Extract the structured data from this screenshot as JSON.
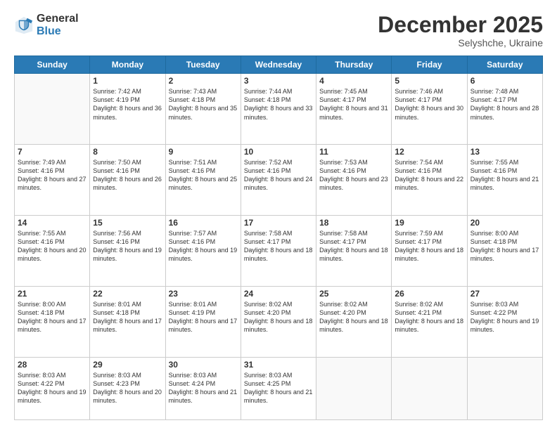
{
  "logo": {
    "general": "General",
    "blue": "Blue"
  },
  "header": {
    "month": "December 2025",
    "location": "Selyshche, Ukraine"
  },
  "days": [
    "Sunday",
    "Monday",
    "Tuesday",
    "Wednesday",
    "Thursday",
    "Friday",
    "Saturday"
  ],
  "weeks": [
    [
      {
        "num": "",
        "sunrise": "",
        "sunset": "",
        "daylight": ""
      },
      {
        "num": "1",
        "sunrise": "Sunrise: 7:42 AM",
        "sunset": "Sunset: 4:19 PM",
        "daylight": "Daylight: 8 hours and 36 minutes."
      },
      {
        "num": "2",
        "sunrise": "Sunrise: 7:43 AM",
        "sunset": "Sunset: 4:18 PM",
        "daylight": "Daylight: 8 hours and 35 minutes."
      },
      {
        "num": "3",
        "sunrise": "Sunrise: 7:44 AM",
        "sunset": "Sunset: 4:18 PM",
        "daylight": "Daylight: 8 hours and 33 minutes."
      },
      {
        "num": "4",
        "sunrise": "Sunrise: 7:45 AM",
        "sunset": "Sunset: 4:17 PM",
        "daylight": "Daylight: 8 hours and 31 minutes."
      },
      {
        "num": "5",
        "sunrise": "Sunrise: 7:46 AM",
        "sunset": "Sunset: 4:17 PM",
        "daylight": "Daylight: 8 hours and 30 minutes."
      },
      {
        "num": "6",
        "sunrise": "Sunrise: 7:48 AM",
        "sunset": "Sunset: 4:17 PM",
        "daylight": "Daylight: 8 hours and 28 minutes."
      }
    ],
    [
      {
        "num": "7",
        "sunrise": "Sunrise: 7:49 AM",
        "sunset": "Sunset: 4:16 PM",
        "daylight": "Daylight: 8 hours and 27 minutes."
      },
      {
        "num": "8",
        "sunrise": "Sunrise: 7:50 AM",
        "sunset": "Sunset: 4:16 PM",
        "daylight": "Daylight: 8 hours and 26 minutes."
      },
      {
        "num": "9",
        "sunrise": "Sunrise: 7:51 AM",
        "sunset": "Sunset: 4:16 PM",
        "daylight": "Daylight: 8 hours and 25 minutes."
      },
      {
        "num": "10",
        "sunrise": "Sunrise: 7:52 AM",
        "sunset": "Sunset: 4:16 PM",
        "daylight": "Daylight: 8 hours and 24 minutes."
      },
      {
        "num": "11",
        "sunrise": "Sunrise: 7:53 AM",
        "sunset": "Sunset: 4:16 PM",
        "daylight": "Daylight: 8 hours and 23 minutes."
      },
      {
        "num": "12",
        "sunrise": "Sunrise: 7:54 AM",
        "sunset": "Sunset: 4:16 PM",
        "daylight": "Daylight: 8 hours and 22 minutes."
      },
      {
        "num": "13",
        "sunrise": "Sunrise: 7:55 AM",
        "sunset": "Sunset: 4:16 PM",
        "daylight": "Daylight: 8 hours and 21 minutes."
      }
    ],
    [
      {
        "num": "14",
        "sunrise": "Sunrise: 7:55 AM",
        "sunset": "Sunset: 4:16 PM",
        "daylight": "Daylight: 8 hours and 20 minutes."
      },
      {
        "num": "15",
        "sunrise": "Sunrise: 7:56 AM",
        "sunset": "Sunset: 4:16 PM",
        "daylight": "Daylight: 8 hours and 19 minutes."
      },
      {
        "num": "16",
        "sunrise": "Sunrise: 7:57 AM",
        "sunset": "Sunset: 4:16 PM",
        "daylight": "Daylight: 8 hours and 19 minutes."
      },
      {
        "num": "17",
        "sunrise": "Sunrise: 7:58 AM",
        "sunset": "Sunset: 4:17 PM",
        "daylight": "Daylight: 8 hours and 18 minutes."
      },
      {
        "num": "18",
        "sunrise": "Sunrise: 7:58 AM",
        "sunset": "Sunset: 4:17 PM",
        "daylight": "Daylight: 8 hours and 18 minutes."
      },
      {
        "num": "19",
        "sunrise": "Sunrise: 7:59 AM",
        "sunset": "Sunset: 4:17 PM",
        "daylight": "Daylight: 8 hours and 18 minutes."
      },
      {
        "num": "20",
        "sunrise": "Sunrise: 8:00 AM",
        "sunset": "Sunset: 4:18 PM",
        "daylight": "Daylight: 8 hours and 17 minutes."
      }
    ],
    [
      {
        "num": "21",
        "sunrise": "Sunrise: 8:00 AM",
        "sunset": "Sunset: 4:18 PM",
        "daylight": "Daylight: 8 hours and 17 minutes."
      },
      {
        "num": "22",
        "sunrise": "Sunrise: 8:01 AM",
        "sunset": "Sunset: 4:18 PM",
        "daylight": "Daylight: 8 hours and 17 minutes."
      },
      {
        "num": "23",
        "sunrise": "Sunrise: 8:01 AM",
        "sunset": "Sunset: 4:19 PM",
        "daylight": "Daylight: 8 hours and 17 minutes."
      },
      {
        "num": "24",
        "sunrise": "Sunrise: 8:02 AM",
        "sunset": "Sunset: 4:20 PM",
        "daylight": "Daylight: 8 hours and 18 minutes."
      },
      {
        "num": "25",
        "sunrise": "Sunrise: 8:02 AM",
        "sunset": "Sunset: 4:20 PM",
        "daylight": "Daylight: 8 hours and 18 minutes."
      },
      {
        "num": "26",
        "sunrise": "Sunrise: 8:02 AM",
        "sunset": "Sunset: 4:21 PM",
        "daylight": "Daylight: 8 hours and 18 minutes."
      },
      {
        "num": "27",
        "sunrise": "Sunrise: 8:03 AM",
        "sunset": "Sunset: 4:22 PM",
        "daylight": "Daylight: 8 hours and 19 minutes."
      }
    ],
    [
      {
        "num": "28",
        "sunrise": "Sunrise: 8:03 AM",
        "sunset": "Sunset: 4:22 PM",
        "daylight": "Daylight: 8 hours and 19 minutes."
      },
      {
        "num": "29",
        "sunrise": "Sunrise: 8:03 AM",
        "sunset": "Sunset: 4:23 PM",
        "daylight": "Daylight: 8 hours and 20 minutes."
      },
      {
        "num": "30",
        "sunrise": "Sunrise: 8:03 AM",
        "sunset": "Sunset: 4:24 PM",
        "daylight": "Daylight: 8 hours and 21 minutes."
      },
      {
        "num": "31",
        "sunrise": "Sunrise: 8:03 AM",
        "sunset": "Sunset: 4:25 PM",
        "daylight": "Daylight: 8 hours and 21 minutes."
      },
      {
        "num": "",
        "sunrise": "",
        "sunset": "",
        "daylight": ""
      },
      {
        "num": "",
        "sunrise": "",
        "sunset": "",
        "daylight": ""
      },
      {
        "num": "",
        "sunrise": "",
        "sunset": "",
        "daylight": ""
      }
    ]
  ]
}
